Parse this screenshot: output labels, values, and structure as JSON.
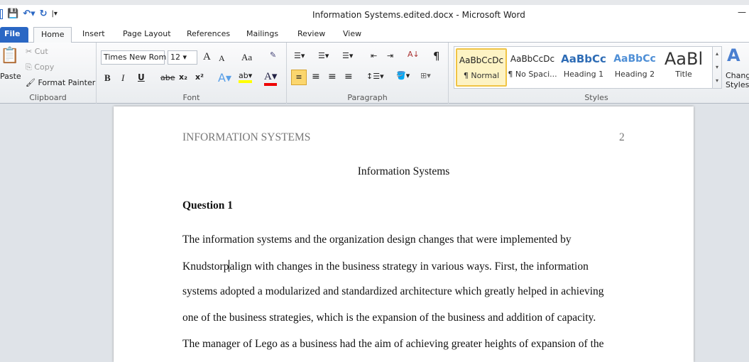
{
  "window": {
    "title": "Information Systems.edited.docx  -  Microsoft Word",
    "minimize": "—"
  },
  "tabs": [
    "File",
    "Home",
    "Insert",
    "Page Layout",
    "References",
    "Mailings",
    "Review",
    "View"
  ],
  "clipboard": {
    "paste": "Paste",
    "cut": "Cut",
    "copy": "Copy",
    "format_painter": "Format Painter",
    "label": "Clipboard"
  },
  "font": {
    "name": "Times New Rom",
    "size": "12",
    "label": "Font",
    "bold": "B",
    "italic": "I",
    "underline": "U",
    "strike": "abe",
    "sub": "x₂",
    "sup": "x²",
    "case": "Aa",
    "grow": "A",
    "shrink": "A"
  },
  "paragraph": {
    "label": "Paragraph",
    "pilcrow": "¶"
  },
  "styles": {
    "label": "Styles",
    "items": [
      {
        "preview": "AaBbCcDc",
        "name": "¶ Normal",
        "color": "#000000"
      },
      {
        "preview": "AaBbCcDc",
        "name": "¶ No Spaci...",
        "color": "#000000"
      },
      {
        "preview": "AaBbCc",
        "name": "Heading 1",
        "color": "#2e6cb5"
      },
      {
        "preview": "AaBbCc",
        "name": "Heading 2",
        "color": "#4f8fd6"
      },
      {
        "preview": "AaBl",
        "name": "Title",
        "color": "#333333"
      }
    ],
    "change_styles": [
      "Change",
      "Styles"
    ]
  },
  "document": {
    "header": "INFORMATION SYSTEMS",
    "page_number": "2",
    "title": "Information Systems",
    "heading": "Question 1",
    "lines": [
      "The information systems and the organization design changes that were implemented by",
      [
        "Knudstorp",
        "align with changes in the business strategy in various ways. First, the information"
      ],
      "systems adopted a modularized and standardized architecture which greatly helped in achieving",
      "one of the business strategies, which is the expansion of the business and addition of capacity.",
      "The manager of Lego as a business had the aim of achieving greater heights of expansion of the"
    ]
  }
}
